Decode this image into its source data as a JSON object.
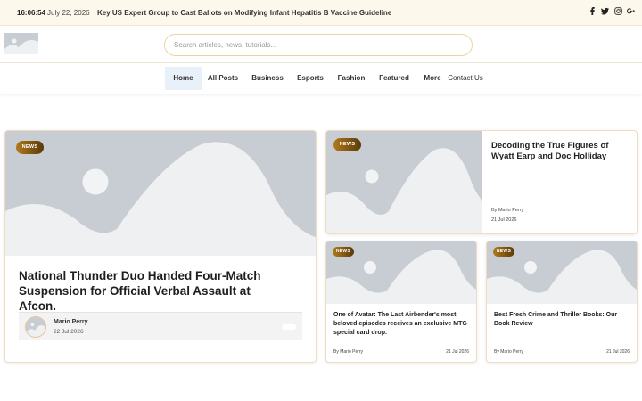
{
  "topbar": {
    "time": "16:06:54",
    "date": "July 22, 2026",
    "ticker": "Key US Expert Group to Cast Ballots on Modifying Infant Hepatitis B Vaccine Guideline",
    "social_icons": [
      "facebook-icon",
      "twitter-icon",
      "instagram-icon",
      "google-plus-icon"
    ]
  },
  "header": {
    "search_placeholder": "Search articles, news, tutorials..."
  },
  "nav": {
    "items": [
      "Home",
      "All Posts",
      "Business",
      "Esports",
      "Fashion",
      "Featured",
      "More",
      "Contact Us"
    ],
    "active": "Home"
  },
  "featured": {
    "badge": "NEWS",
    "title": "National Thunder Duo Handed Four-Match Suspension for Official Verbal Assault at Afcon.",
    "author": "Mario Perry",
    "date": "22 Jul 2026"
  },
  "right_top": {
    "badge": "NEWS",
    "title": "Decoding the True Figures of Wyatt Earp and Doc Holliday",
    "author": "By Mario Perry",
    "date": "21 Jul 2026"
  },
  "card_a": {
    "badge": "NEWS",
    "title": "One of Avatar: The Last Airbender's most beloved episodes receives an exclusive MTG special card drop.",
    "author": "By Mario Perry",
    "date": "21 Jul 2026"
  },
  "card_b": {
    "badge": "NEWS",
    "title": "Best Fresh Crime and Thriller Books: Our Book Review",
    "author": "By Mario Perry",
    "date": "21 Jul 2026"
  },
  "colors": {
    "accent": "#ecd49e",
    "badge_gradient_start": "#b07a1c",
    "badge_gradient_end": "#5a3a08",
    "topbar_bg": "#fdf8ec",
    "nav_active_bg": "#e8f0fa"
  }
}
